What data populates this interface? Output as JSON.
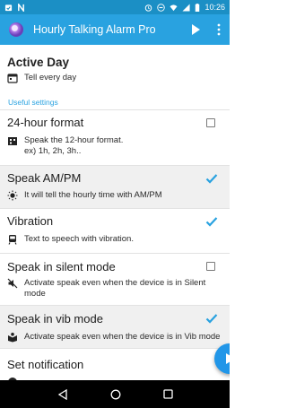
{
  "status_bar": {
    "time": "10:26"
  },
  "app_bar": {
    "title": "Hourly Talking Alarm Pro"
  },
  "settings": {
    "active_day": {
      "title": "Active Day",
      "value": "Tell every day"
    },
    "section_label": "Useful settings",
    "items": [
      {
        "title": "24-hour format",
        "summary": "Speak the 12-hour format.\nex) 1h, 2h, 3h..",
        "checked": false
      },
      {
        "title": "Speak AM/PM",
        "summary": "It will tell the hourly time with AM/PM",
        "checked": true
      },
      {
        "title": "Vibration",
        "summary": "Text to speech with vibration.",
        "checked": true
      },
      {
        "title": "Speak in silent mode",
        "summary": "Activate speak even when the device is in Silent mode",
        "checked": false
      },
      {
        "title": "Speak in vib mode",
        "summary": "Activate speak even when the device is in Vib mode",
        "checked": true
      },
      {
        "title": "Set notification",
        "summary": "",
        "checked": false
      }
    ]
  },
  "colors": {
    "primary": "#29a2e0",
    "status_bar": "#1b8fc5",
    "accent": "#2196e8"
  }
}
